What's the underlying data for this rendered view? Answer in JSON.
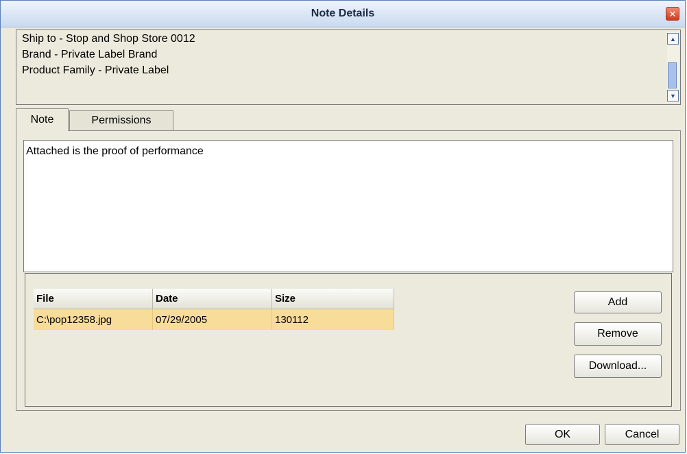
{
  "window": {
    "title": "Note Details"
  },
  "info": {
    "lines": [
      "Ship to - Stop and Shop Store 0012",
      "Brand - Private Label Brand",
      "Product Family - Private Label"
    ]
  },
  "tabs": [
    {
      "label": "Note",
      "selected": true
    },
    {
      "label": "Permissions",
      "selected": false
    }
  ],
  "note": {
    "text": "Attached is the proof of performance"
  },
  "attachments": {
    "columns": [
      "File",
      "Date",
      "Size"
    ],
    "rows": [
      {
        "file": "C:\\pop12358.jpg",
        "date": "07/29/2005",
        "size": "130112"
      }
    ]
  },
  "buttons": {
    "add": "Add",
    "remove": "Remove",
    "download": "Download...",
    "ok": "OK",
    "cancel": "Cancel"
  },
  "icons": {
    "close": "close-icon",
    "scroll_up": "arrow-up-icon",
    "scroll_down": "arrow-down-icon"
  },
  "colors": {
    "title_bar": "#c9daf0",
    "dialog_bg": "#ebeadd",
    "selected_row": "#f7dc9a",
    "close_button": "#cf3a1e"
  }
}
